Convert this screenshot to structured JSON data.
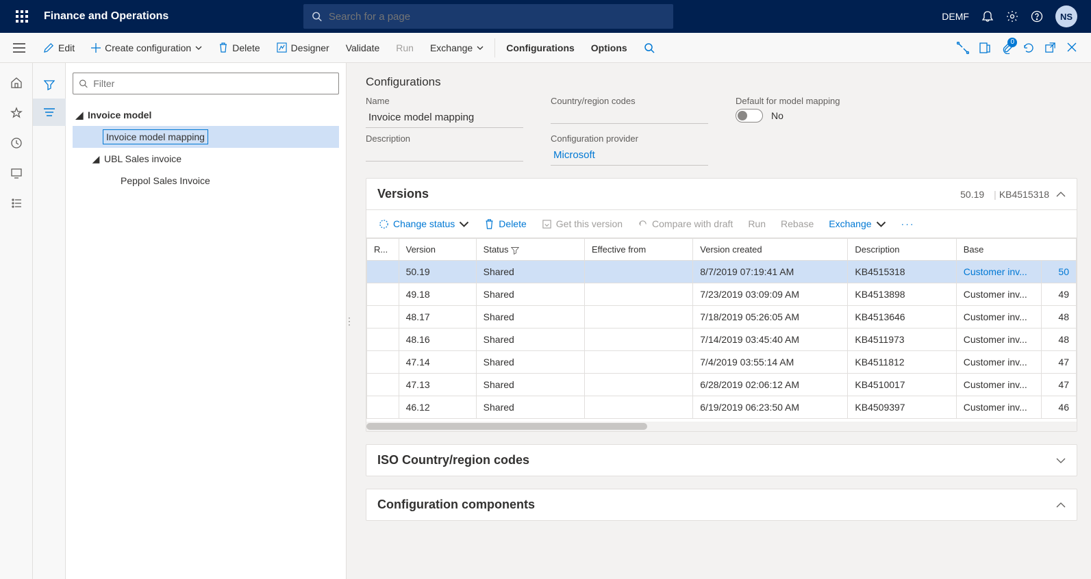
{
  "header": {
    "product": "Finance and Operations",
    "search_placeholder": "Search for a page",
    "company": "DEMF",
    "avatar": "NS"
  },
  "cmdbar": {
    "edit": "Edit",
    "create_config": "Create configuration",
    "delete": "Delete",
    "designer": "Designer",
    "validate": "Validate",
    "run": "Run",
    "exchange": "Exchange",
    "configurations": "Configurations",
    "options": "Options",
    "attach_badge": "0"
  },
  "tree": {
    "filter_placeholder": "Filter",
    "root": "Invoice model",
    "items": [
      "Invoice model mapping",
      "UBL Sales invoice",
      "Peppol Sales Invoice"
    ]
  },
  "details": {
    "section_title": "Configurations",
    "name_label": "Name",
    "name_value": "Invoice model mapping",
    "country_label": "Country/region codes",
    "country_value": "",
    "default_label": "Default for model mapping",
    "default_value": "No",
    "desc_label": "Description",
    "desc_value": "",
    "provider_label": "Configuration provider",
    "provider_value": "Microsoft"
  },
  "versions": {
    "title": "Versions",
    "summary_version": "50.19",
    "summary_kb": "KB4515318",
    "toolbar": {
      "change_status": "Change status",
      "delete": "Delete",
      "get": "Get this version",
      "compare": "Compare with draft",
      "run": "Run",
      "rebase": "Rebase",
      "exchange": "Exchange"
    },
    "columns": {
      "r": "R...",
      "version": "Version",
      "status": "Status",
      "effective": "Effective from",
      "created": "Version created",
      "desc": "Description",
      "base": "Base"
    },
    "rows": [
      {
        "version": "50.19",
        "status": "Shared",
        "effective": "",
        "created": "8/7/2019 07:19:41 AM",
        "desc": "KB4515318",
        "base": "Customer inv...",
        "basenum": "50"
      },
      {
        "version": "49.18",
        "status": "Shared",
        "effective": "",
        "created": "7/23/2019 03:09:09 AM",
        "desc": "KB4513898",
        "base": "Customer inv...",
        "basenum": "49"
      },
      {
        "version": "48.17",
        "status": "Shared",
        "effective": "",
        "created": "7/18/2019 05:26:05 AM",
        "desc": "KB4513646",
        "base": "Customer inv...",
        "basenum": "48"
      },
      {
        "version": "48.16",
        "status": "Shared",
        "effective": "",
        "created": "7/14/2019 03:45:40 AM",
        "desc": "KB4511973",
        "base": "Customer inv...",
        "basenum": "48"
      },
      {
        "version": "47.14",
        "status": "Shared",
        "effective": "",
        "created": "7/4/2019 03:55:14 AM",
        "desc": "KB4511812",
        "base": "Customer inv...",
        "basenum": "47"
      },
      {
        "version": "47.13",
        "status": "Shared",
        "effective": "",
        "created": "6/28/2019 02:06:12 AM",
        "desc": "KB4510017",
        "base": "Customer inv...",
        "basenum": "47"
      },
      {
        "version": "46.12",
        "status": "Shared",
        "effective": "",
        "created": "6/19/2019 06:23:50 AM",
        "desc": "KB4509397",
        "base": "Customer inv...",
        "basenum": "46"
      }
    ]
  },
  "iso_section": "ISO Country/region codes",
  "components_section": "Configuration components"
}
